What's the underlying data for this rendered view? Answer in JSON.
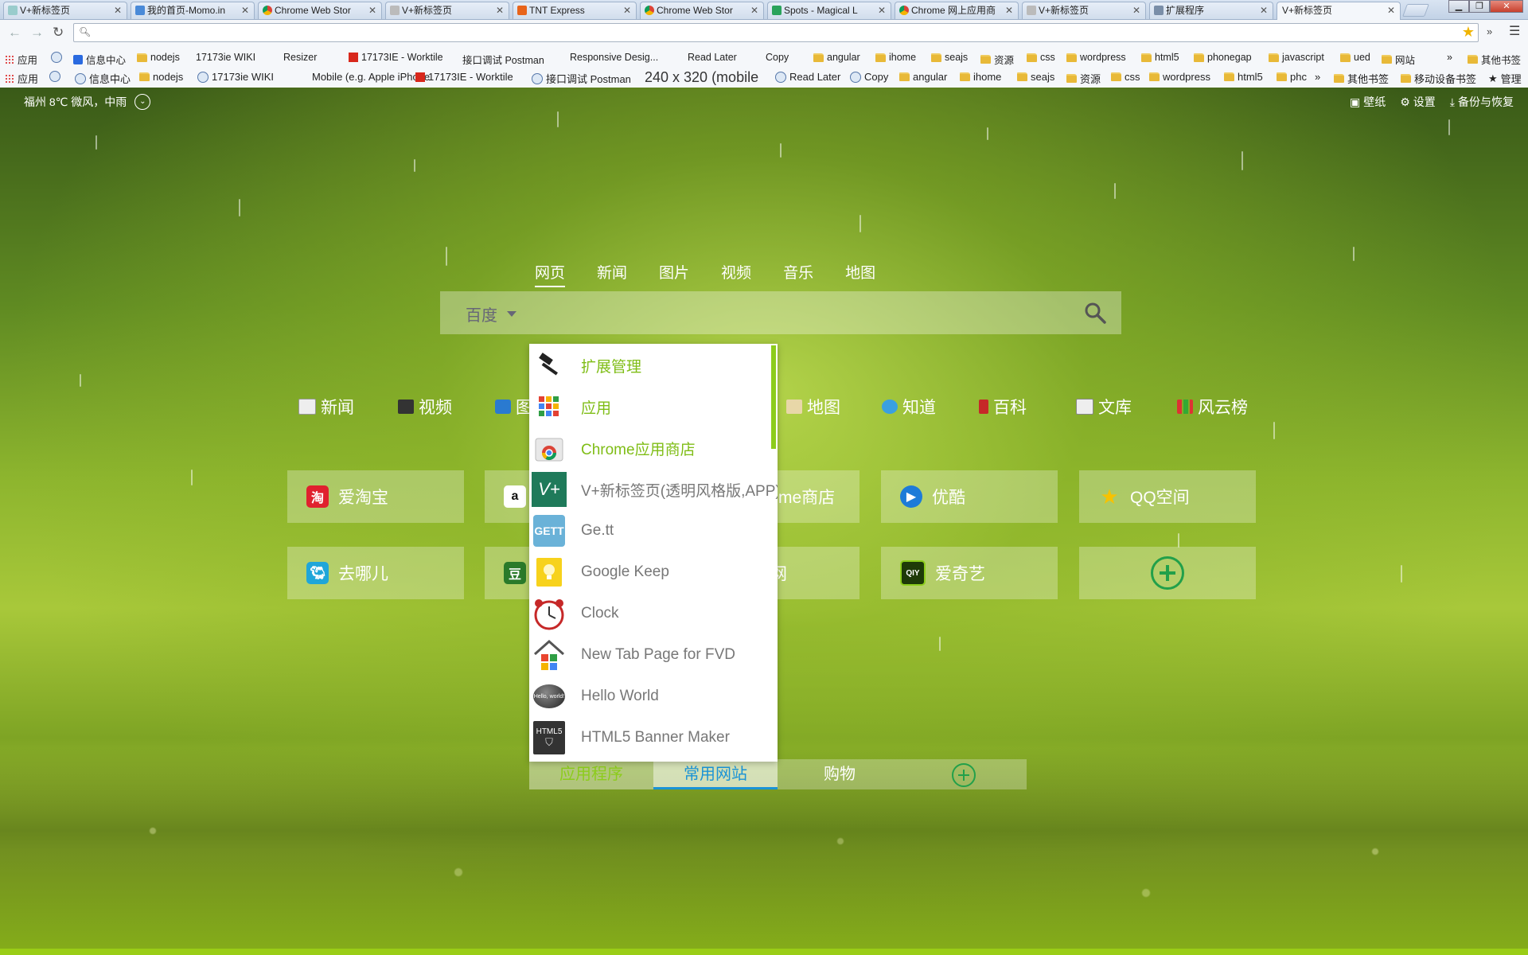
{
  "browser": {
    "tabs": [
      {
        "title": "V+新标签页",
        "active": false
      },
      {
        "title": "我的首页-Momo.in",
        "active": false
      },
      {
        "title": "Chrome Web Stor",
        "active": false
      },
      {
        "title": "V+新标签页",
        "active": false
      },
      {
        "title": "TNT Express",
        "active": false
      },
      {
        "title": "Chrome Web Stor",
        "active": false
      },
      {
        "title": "Spots - Magical L",
        "active": false
      },
      {
        "title": "Chrome 网上应用商",
        "active": false
      },
      {
        "title": "V+新标签页",
        "active": false
      },
      {
        "title": "扩展程序",
        "active": false
      },
      {
        "title": "V+新标签页",
        "active": true
      }
    ],
    "address": "",
    "bookmarks_row1": [
      "应用",
      "信息中心",
      "nodejs",
      "17173ie WIKI",
      "Resizer",
      "17173IE - Worktile",
      "接口调试 Postman",
      "Responsive Desig...",
      "Read Later",
      "Copy",
      "angular",
      "ihome",
      "seajs",
      "资源",
      "css",
      "wordpress",
      "html5",
      "phonegap",
      "javascript",
      "ued",
      "网站"
    ],
    "bookmarks_row1_more": "»",
    "bookmarks_row1_other": "其他书签",
    "bookmarks_row2": [
      "应用",
      "信息中心",
      "nodejs",
      "17173ie WIKI",
      "Mobile (e.g. Apple iPhone",
      "17173IE - Worktile",
      "接口调试 Postman"
    ],
    "bookmarks_row2_resize": "240 x 320 (mobile",
    "bookmarks_row2_b": [
      "Read Later",
      "Copy",
      "angular",
      "ihome",
      "seajs",
      "资源",
      "css",
      "wordpress",
      "html5",
      "phc"
    ],
    "bookmarks_row2_more": "»",
    "bookmarks_row2_right": [
      "其他书签",
      "移动设备书签",
      "管理"
    ]
  },
  "page": {
    "weather": "福州 8℃ 微风，中雨",
    "top_actions": [
      "壁纸",
      "设置",
      "备份与恢复"
    ],
    "search_tabs": [
      "网页",
      "新闻",
      "图片",
      "视频",
      "音乐",
      "地图"
    ],
    "search_engine": "百度",
    "search_value": "",
    "nav_links": [
      "新闻",
      "视频",
      "图",
      "地图",
      "知道",
      "百科",
      "文库",
      "风云榜"
    ],
    "tiles_row1": [
      "爱淘宝",
      "",
      "me商店",
      "优酷",
      "QQ空间"
    ],
    "tiles_row2": [
      "去哪儿",
      "",
      "网",
      "爱奇艺",
      ""
    ],
    "bottom_tabs": [
      "应用程序",
      "常用网站",
      "购物"
    ],
    "apps": [
      {
        "name": "扩展管理",
        "icon": "hammer-icon"
      },
      {
        "name": "应用",
        "icon": "apps-grid-icon"
      },
      {
        "name": "Chrome应用商店",
        "icon": "chrome-store-icon"
      },
      {
        "name": "V+新标签页(透明风格版,APP)",
        "icon": "vplus-icon"
      },
      {
        "name": "Ge.tt",
        "icon": "gett-icon"
      },
      {
        "name": "Google Keep",
        "icon": "keep-bulb-icon"
      },
      {
        "name": "Clock",
        "icon": "alarm-clock-icon"
      },
      {
        "name": "New Tab Page for FVD",
        "icon": "house-icon"
      },
      {
        "name": "Hello World",
        "icon": "hello-world-icon"
      },
      {
        "name": "HTML5 Banner Maker",
        "icon": "html5-banner-icon"
      }
    ]
  }
}
